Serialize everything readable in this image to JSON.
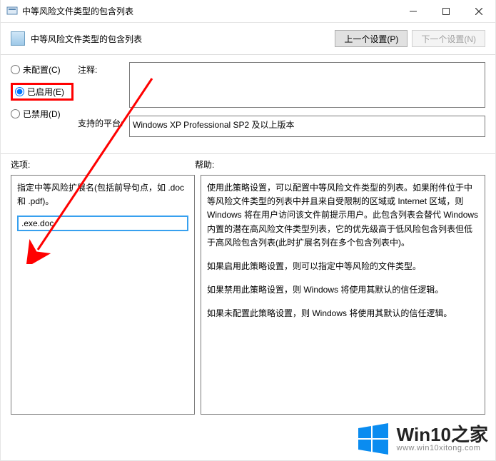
{
  "titlebar": {
    "title": "中等风险文件类型的包含列表"
  },
  "header": {
    "label": "中等风险文件类型的包含列表",
    "prev_button": "上一个设置(P)",
    "next_button": "下一个设置(N)"
  },
  "radios": {
    "not_configured": "未配置(C)",
    "enabled": "已启用(E)",
    "disabled": "已禁用(D)"
  },
  "labels": {
    "comment": "注释:",
    "platform": "支持的平台:",
    "options": "选项:",
    "help": "帮助:"
  },
  "fields": {
    "comment_value": "",
    "platform_value": "Windows XP Professional SP2 及以上版本"
  },
  "options_panel": {
    "desc": "指定中等风险扩展名(包括前导句点，如 .doc 和 .pdf)。",
    "input_value": ".exe.doc"
  },
  "help_panel": {
    "p1": "使用此策略设置，可以配置中等风险文件类型的列表。如果附件位于中等风险文件类型的列表中并且来自受限制的区域或 Internet 区域，则 Windows 将在用户访问该文件前提示用户。此包含列表会替代 Windows 内置的潜在高风险文件类型列表，它的优先级高于低风险包含列表但低于高风险包含列表(此时扩展名列在多个包含列表中)。",
    "p2": "如果启用此策略设置，则可以指定中等风险的文件类型。",
    "p3": "如果禁用此策略设置，则 Windows 将使用其默认的信任逻辑。",
    "p4": "如果未配置此策略设置，则 Windows 将使用其默认的信任逻辑。"
  },
  "watermark": {
    "brand": "Win10之家",
    "url": "www.win10xitong.com"
  }
}
